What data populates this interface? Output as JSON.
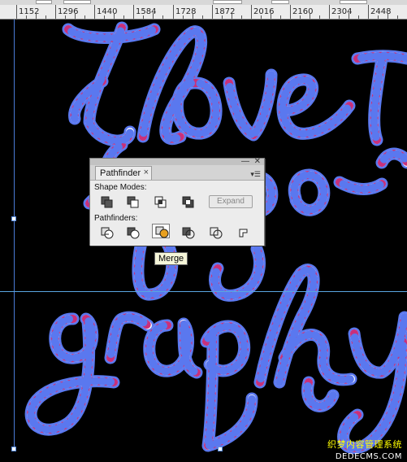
{
  "ruler": {
    "labels": [
      "1152",
      "1296",
      "1440",
      "1584",
      "1728",
      "1872",
      "2016",
      "2160",
      "2304",
      "2448"
    ]
  },
  "panel": {
    "tab_label": "Pathfinder",
    "tab_close": "×",
    "minimize_glyph": "—",
    "close_glyph": "✕",
    "menu_glyph": "▾☰",
    "shape_modes_label": "Shape Modes:",
    "pathfinders_label": "Pathfinders:",
    "expand_label": "Expand",
    "shape_modes": [
      "unite-icon",
      "minus-front-icon",
      "intersect-icon",
      "exclude-icon"
    ],
    "pathfinders": [
      "divide-icon",
      "trim-icon",
      "merge-icon",
      "crop-icon",
      "outline-icon",
      "minus-back-icon"
    ],
    "pressed": "merge-icon"
  },
  "tooltip": {
    "text": "Merge"
  },
  "watermark": {
    "line1": "织梦内容管理系统",
    "line2": "DEDECMS.COM"
  },
  "colors": {
    "rope_outline": "#5a78ef",
    "rope_inner": "#fbfbff",
    "rope_stripe": "#c9307a",
    "canvas": "#000000",
    "guide": "#4a7bd6"
  }
}
